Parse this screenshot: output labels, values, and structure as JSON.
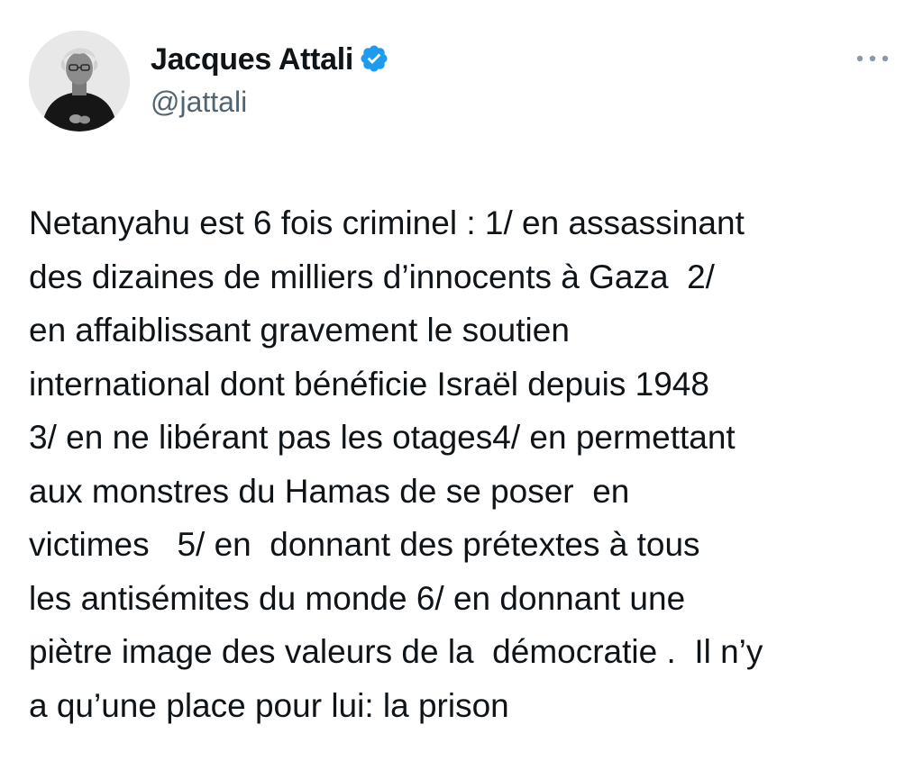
{
  "author": {
    "name": "Jacques Attali",
    "handle": "@jattali",
    "verified": true,
    "verified_color": "#1d9bf0"
  },
  "icons": {
    "avatar": "profile-photo",
    "verified": "verified-badge-icon",
    "more": "more-options-icon"
  },
  "tweet": {
    "lines": [
      "Netanyahu est 6 fois criminel : 1/ en assassinant",
      "des dizaines de milliers d’innocents à Gaza  2/",
      "en affaiblissant gravement le soutien",
      "international dont bénéficie Israël depuis 1948",
      "3/ en ne libérant pas les otages4/ en permettant",
      "aux monstres du Hamas de se poser  en",
      "victimes   5/ en  donnant des prétextes à tous",
      "les antisémites du monde 6/ en donnant une",
      "piètre image des valeurs de la  démocratie .  Il n’y",
      "a qu’une place pour lui: la prison"
    ]
  },
  "colors": {
    "text": "#0f1419",
    "secondary": "#536471",
    "background": "#ffffff"
  }
}
